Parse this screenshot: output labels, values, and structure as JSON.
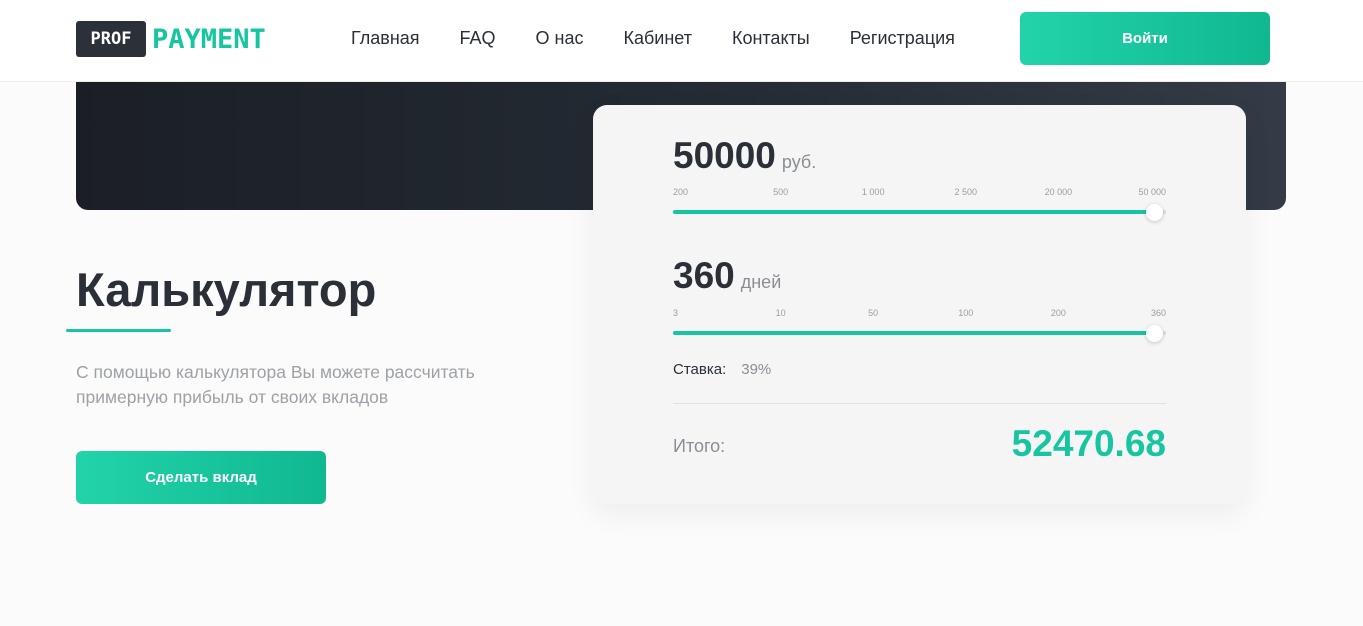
{
  "header": {
    "logo_box": "PROF",
    "logo_text": "PAYMENT",
    "nav": [
      "Главная",
      "FAQ",
      "О нас",
      "Кабинет",
      "Контакты",
      "Регистрация"
    ],
    "login_label": "Войти"
  },
  "hero": {
    "title": "Калькулятор",
    "description": "С помощью калькулятора Вы можете рассчитать примерную прибыль от своих вкладов",
    "deposit_label": "Сделать вклад"
  },
  "calculator": {
    "amount": {
      "value": "50000",
      "unit": "руб.",
      "ticks": [
        "200",
        "500",
        "1 000",
        "2 500",
        "20 000",
        "50 000"
      ],
      "level": 0.975
    },
    "days": {
      "value": "360",
      "unit": "дней",
      "ticks": [
        "3",
        "10",
        "50",
        "100",
        "200",
        "360"
      ],
      "level": 0.975
    },
    "rate_label": "Ставка:",
    "rate_value": "39%",
    "total_label": "Итого:",
    "total_value": "52470.68"
  },
  "colors": {
    "accent": "#17c6a0",
    "dark": "#2a2f38",
    "hero_dark": "#1b1f25"
  }
}
